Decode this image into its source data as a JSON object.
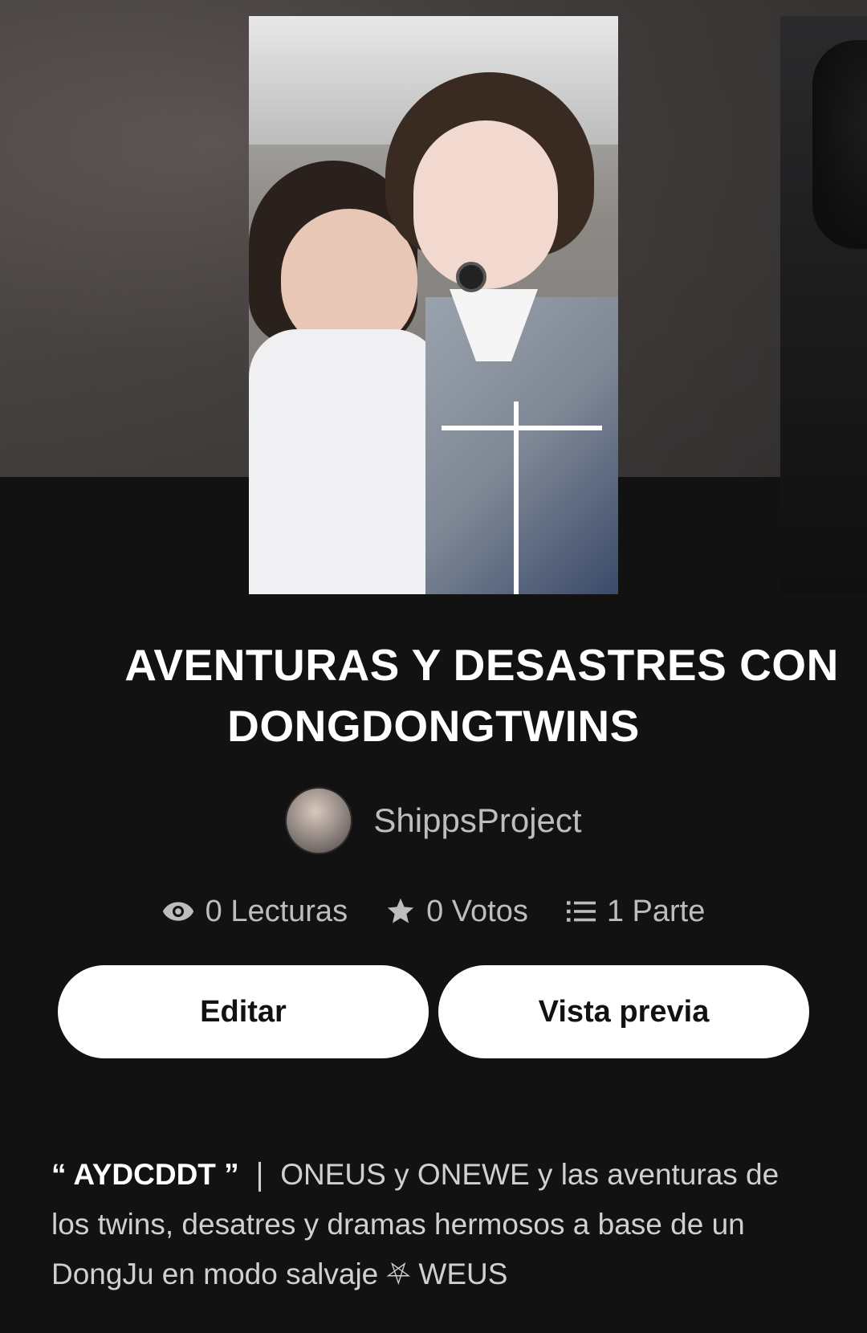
{
  "story": {
    "title_line1": "AVENTURAS Y DESASTRES CON",
    "title_line2": "DONGDONGTWINS",
    "author": "ShippsProject"
  },
  "stats": {
    "reads": "0 Lecturas",
    "votes": "0 Votos",
    "parts": "1 Parte"
  },
  "actions": {
    "edit_label": "Editar",
    "preview_label": "Vista previa"
  },
  "description": {
    "tag": "“ AYDCDDT ”",
    "text": " ❘ ONEUS y ONEWE y las aventuras de los twins, desatres y dramas hermosos a base de un DongJu en modo salvaje ⛧ WEUS"
  },
  "icons": {
    "reads": "eye-icon",
    "votes": "star-icon",
    "parts": "list-icon"
  },
  "colors": {
    "background": "#121212",
    "button_bg": "#ffffff",
    "muted_text": "#bdbdbd"
  }
}
